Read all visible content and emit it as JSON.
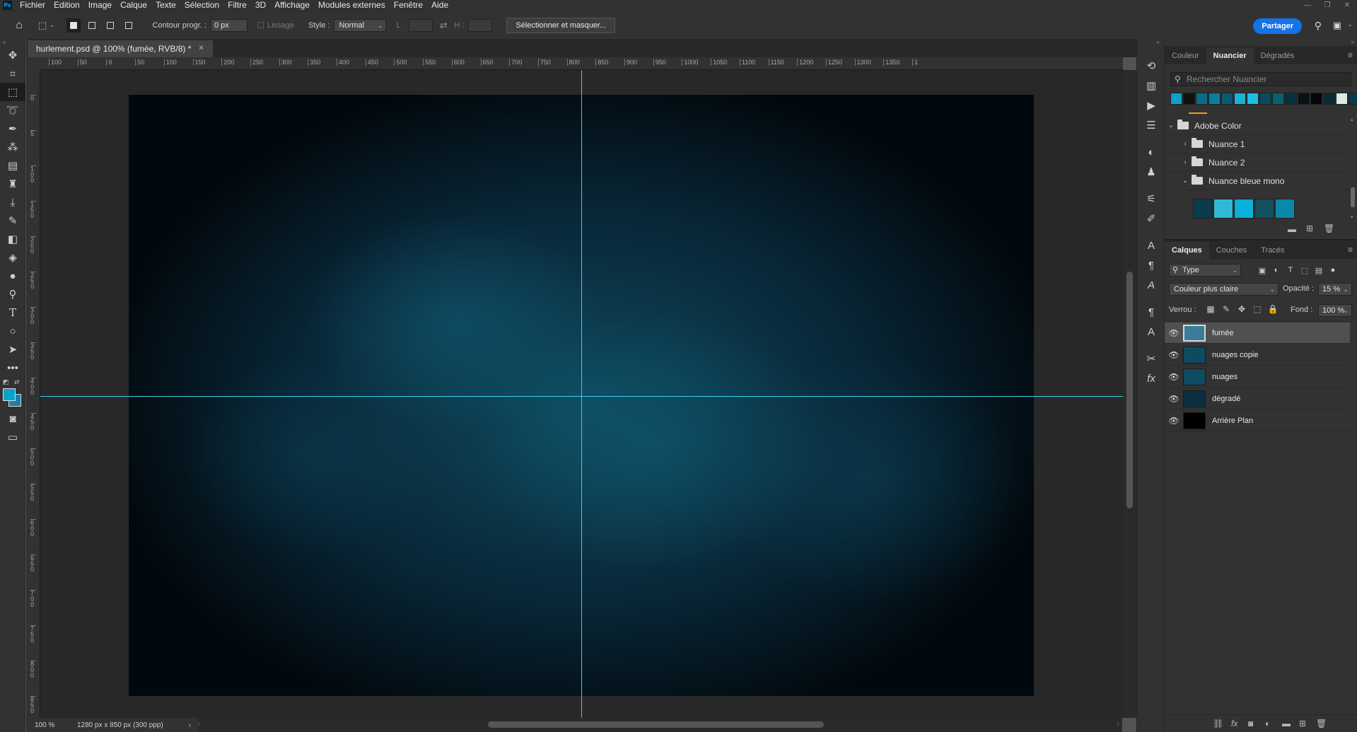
{
  "app": {
    "logo": "Ps"
  },
  "menu": [
    "Fichier",
    "Edition",
    "Image",
    "Calque",
    "Texte",
    "Sélection",
    "Filtre",
    "3D",
    "Affichage",
    "Modules externes",
    "Fenêtre",
    "Aide"
  ],
  "options": {
    "feather_label": "Contour progr. :",
    "feather_value": "0 px",
    "antialias_label": "Lissage",
    "style_label": "Style :",
    "style_value": "Normal",
    "width_label": "L :",
    "height_label": "H :",
    "select_mask_button": "Sélectionner et masquer...",
    "share_button": "Partager"
  },
  "document": {
    "tab_title": "hurlement.psd @ 100% (fumée, RVB/8) *",
    "zoom": "100 %",
    "info": "1280 px x 850 px (300 ppp)"
  },
  "rulers": {
    "h_labels": [
      "100",
      "50",
      "0",
      "50",
      "100",
      "150",
      "200",
      "250",
      "300",
      "350",
      "400",
      "450",
      "500",
      "550",
      "600",
      "650",
      "700",
      "750",
      "800",
      "850",
      "900",
      "950",
      "1000",
      "1050",
      "1100",
      "1150",
      "1200",
      "1250",
      "1300",
      "1350",
      "1"
    ],
    "v_labels": [
      "0",
      "5",
      "1 0 0",
      "1 5 0",
      "2 0 0",
      "2 5 0",
      "3 0 0",
      "3 5 0",
      "4 0 0",
      "4 5 0",
      "5 0 0",
      "5 5 0",
      "6 0 0",
      "6 5 0",
      "7 0 0",
      "7 5 0",
      "8 0 0",
      "8 5 0"
    ]
  },
  "swatches_panel": {
    "tabs": [
      "Couleur",
      "Nuancier",
      "Dégradés"
    ],
    "active_tab": "Nuancier",
    "search_placeholder": "Rechercher Nuancier",
    "recent": [
      "#0aa3c8",
      "#111111",
      "#0a6c88",
      "#0a7f9e",
      "#0a5a70",
      "#18b4d8",
      "#1ec0e0",
      "#0a4a5e",
      "#0a6070",
      "#08323e",
      "#0a1014",
      "#020608",
      "#0a2a36",
      "#d8ece8",
      "#0a3c4a",
      "#20b8c8"
    ],
    "groups": [
      {
        "name": "Adobe Color",
        "expanded": true
      },
      {
        "name": "Nuance 1",
        "expanded": false
      },
      {
        "name": "Nuance 2",
        "expanded": false
      },
      {
        "name": "Nuance bleue mono",
        "expanded": true
      }
    ],
    "group_colors": [
      "#0a3c4c",
      "#30b8d8",
      "#0ab0d8",
      "#14505e",
      "#0a8aa8"
    ]
  },
  "layers_panel": {
    "tabs": [
      "Calques",
      "Couches",
      "Tracés"
    ],
    "active_tab": "Calques",
    "filter": "Type",
    "blend_mode": "Couleur plus claire",
    "opacity_label": "Opacité :",
    "opacity_value": "15 %",
    "lock_label": "Verrou :",
    "fill_label": "Fond :",
    "fill_value": "100 %",
    "layers": [
      {
        "name": "fumée",
        "selected": true,
        "thumb": "#3a7c9a"
      },
      {
        "name": "nuages copie",
        "selected": false,
        "thumb": "#0e4a60"
      },
      {
        "name": "nuages",
        "selected": false,
        "thumb": "#0e4a60"
      },
      {
        "name": "dégradé",
        "selected": false,
        "thumb": "#0a3040"
      },
      {
        "name": "Arrière Plan",
        "selected": false,
        "thumb": "#000000"
      }
    ]
  },
  "colors": {
    "foreground": "#0aa3c8",
    "background": "#1e7fa6",
    "guide": "#35d4e8",
    "accent": "#1473e6"
  }
}
